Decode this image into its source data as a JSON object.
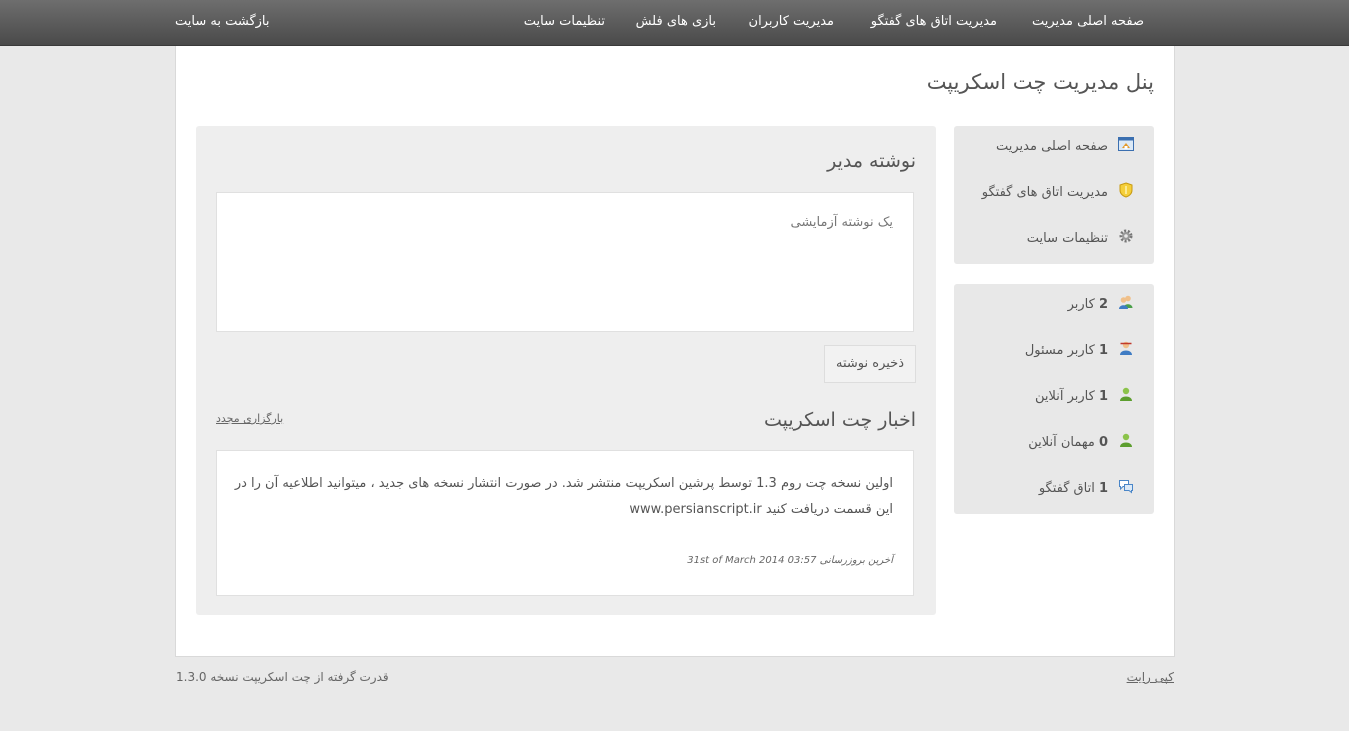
{
  "topnav": {
    "items": [
      {
        "label": "صفحه اصلی مدیریت",
        "key": "home"
      },
      {
        "label": "مدیریت اتاق های گفتگو",
        "key": "rooms"
      },
      {
        "label": "مدیریت کاربران",
        "key": "users"
      },
      {
        "label": "بازی های فلش",
        "key": "games"
      },
      {
        "label": "تنظیمات سایت",
        "key": "settings"
      }
    ],
    "back_label": "بازگشت به سایت"
  },
  "page": {
    "title": "پنل مدیریت چت اسکریپت"
  },
  "sidebar": {
    "menu": [
      {
        "label": "صفحه اصلی مدیریت",
        "icon": "dashboard-icon"
      },
      {
        "label": "مدیریت اتاق های گفتگو",
        "icon": "shield-icon"
      },
      {
        "label": "تنظیمات سایت",
        "icon": "gear-icon"
      }
    ],
    "stats": [
      {
        "count": "2",
        "label": "کاربر",
        "icon": "users-icon"
      },
      {
        "count": "1",
        "label": "کاربر مسئول",
        "icon": "admin-user-icon"
      },
      {
        "count": "1",
        "label": "کاربر آنلاین",
        "icon": "online-user-icon"
      },
      {
        "count": "0",
        "label": "مهمان آنلاین",
        "icon": "guest-user-icon"
      },
      {
        "count": "1",
        "label": "اتاق گفتگو",
        "icon": "chat-bubble-icon"
      }
    ]
  },
  "admin_note": {
    "title": "نوشته مدیر",
    "text": "یک نوشته آزمایشی",
    "save_label": "ذخیره نوشته"
  },
  "news": {
    "title": "اخبار چت اسکریپت",
    "reload_label": "بارگزاری مجدد",
    "body": "اولین نسخه چت روم 1.3 توسط پرشین اسکریپت منتشر شد. در صورت انتشار نسخه های جدید ، میتوانید اطلاعیه آن را در این قسمت دریافت کنید www.persianscript.ir",
    "updated": "آخرین بروزرسانی 31st of March 2014 03:57"
  },
  "footer": {
    "powered": "قدرت گرفته از چت اسکریپت نسخه 1.3.0",
    "copyright": "کپی رایت"
  },
  "colors": {
    "topbar": "#5a5a5a",
    "panel": "#e8e8e8",
    "background": "#e9e9e9"
  }
}
